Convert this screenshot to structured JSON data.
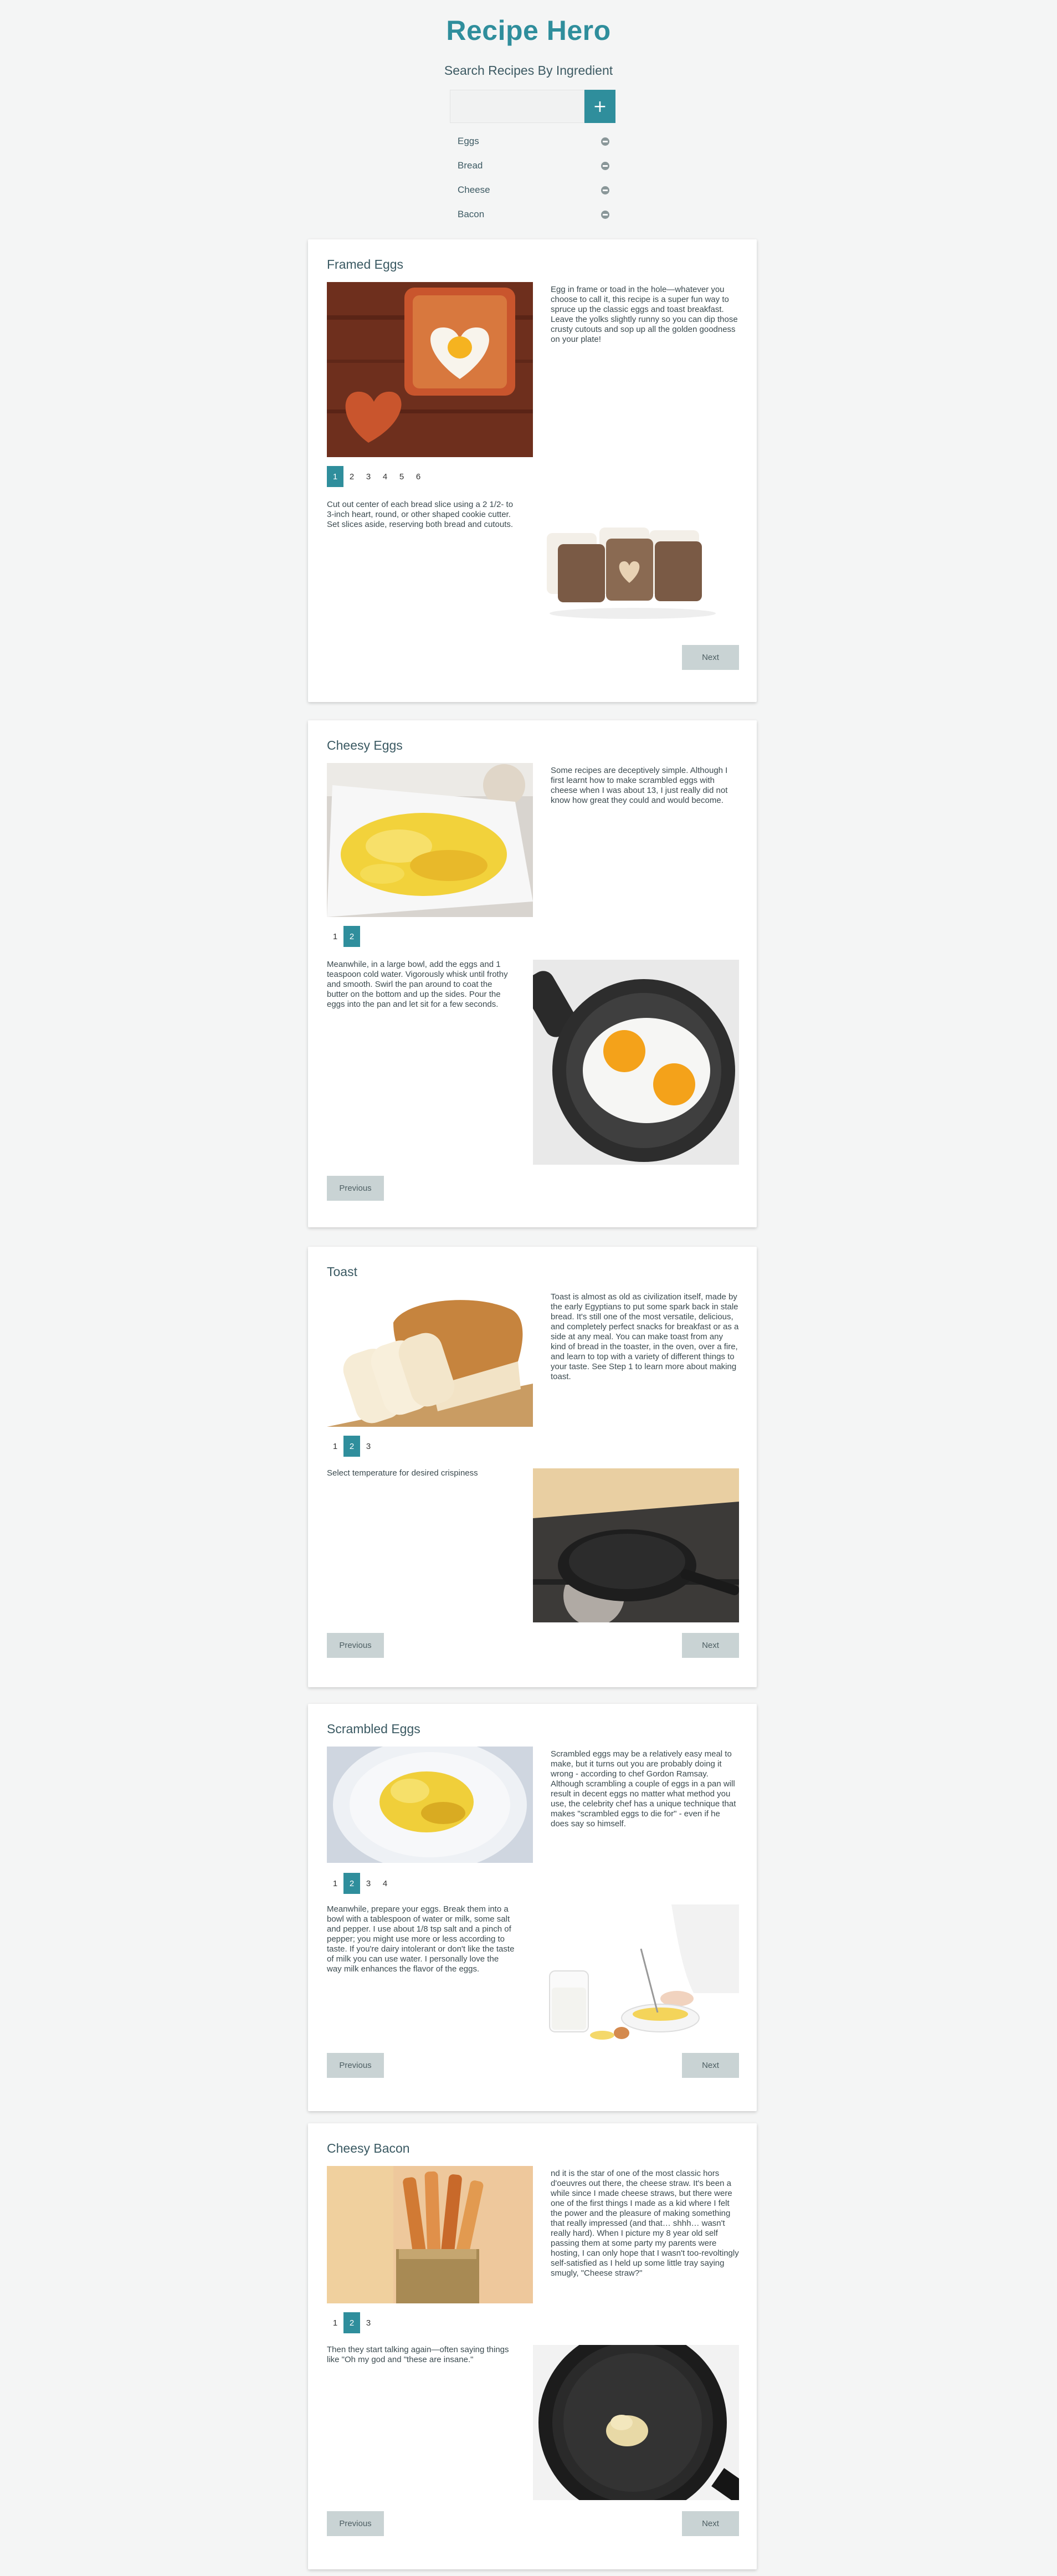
{
  "app": {
    "title": "Recipe Hero"
  },
  "search": {
    "label": "Search Recipes By Ingredient",
    "value": "",
    "placeholder": "",
    "add_symbol": "+"
  },
  "ingredients": [
    {
      "name": "Eggs"
    },
    {
      "name": "Bread"
    },
    {
      "name": "Cheese"
    },
    {
      "name": "Bacon"
    }
  ],
  "recipes": [
    {
      "title": "Framed Eggs",
      "description": "Egg in frame or toad in the hole—whatever you choose to call it, this recipe is a super fun way to spruce up the classic eggs and toast breakfast. Leave the yolks slightly runny so you can dip those crusty cutouts and sop up all the golden goodness on your plate!",
      "pages": [
        "1",
        "2",
        "3",
        "4",
        "5",
        "6"
      ],
      "active_page": "1",
      "step_text": "Cut out center of each bread slice using a 2 1/2- to 3-inch heart, round, or other shaped cookie cutter. Set slices aside, reserving both bread and cutouts.",
      "next_label": "Next"
    },
    {
      "title": "Cheesy Eggs",
      "description": "Some recipes are deceptively simple. Although I first learnt how to make scrambled eggs with cheese when I was about 13, I just really did not know how great they could and would become.",
      "pages": [
        "1",
        "2"
      ],
      "active_page": "2",
      "step_text": "Meanwhile, in a large bowl, add the eggs and 1 teaspoon cold water. Vigorously whisk until frothy and smooth. Swirl the pan around to coat the butter on the bottom and up the sides. Pour the eggs into the pan and let sit for a few seconds.",
      "previous_label": "Previous"
    },
    {
      "title": "Toast",
      "description": "Toast is almost as old as civilization itself, made by the early Egyptians to put some spark back in stale bread. It's still one of the most versatile, delicious, and completely perfect snacks for breakfast or as a side at any meal. You can make toast from any kind of bread in the toaster, in the oven, over a fire, and learn to top with a variety of different things to your taste. See Step 1 to learn more about making toast.",
      "pages": [
        "1",
        "2",
        "3"
      ],
      "active_page": "2",
      "step_text": "Select temperature for desired crispiness",
      "previous_label": "Previous",
      "next_label": "Next"
    },
    {
      "title": "Scrambled Eggs",
      "description": "Scrambled eggs may be a relatively easy meal to make, but it turns out you are probably doing it wrong - according to chef Gordon Ramsay. Although scrambling a couple of eggs in a pan will result in decent eggs no matter what method you use, the celebrity chef has a unique technique that makes \"scrambled eggs to die for\" - even if he does say so himself.",
      "pages": [
        "1",
        "2",
        "3",
        "4"
      ],
      "active_page": "2",
      "step_text": "Meanwhile, prepare your eggs. Break them into a bowl with a tablespoon of water or milk, some salt and pepper. I use about 1/8 tsp salt and a pinch of pepper; you might use more or less according to taste. If you're dairy intolerant or don't like the taste of milk you can use water. I personally love the way milk enhances the flavor of the eggs.",
      "previous_label": "Previous",
      "next_label": "Next"
    },
    {
      "title": "Cheesy Bacon",
      "description": "nd it is the star of one of the most classic hors d'oeuvres out there, the cheese straw. It's been a while since I made cheese straws, but there were one of the first things I made as a kid where I felt the power and the pleasure of making something that really impressed (and that… shhh… wasn't really hard). When I picture my 8 year old self passing them at some party my parents were hosting, I can only hope that I wasn't too-revoltingly self-satisfied as I held up some little tray saying smugly, \"Cheese straw?\"",
      "pages": [
        "1",
        "2",
        "3"
      ],
      "active_page": "2",
      "step_text": "Then they start talking again—often saying things like \"Oh my god and \"these are insane.\"",
      "previous_label": "Previous",
      "next_label": "Next"
    }
  ],
  "colors": {
    "accent": "#2f8e9c",
    "button_bg": "#c9d3d4",
    "page_bg": "#f4f5f5"
  }
}
